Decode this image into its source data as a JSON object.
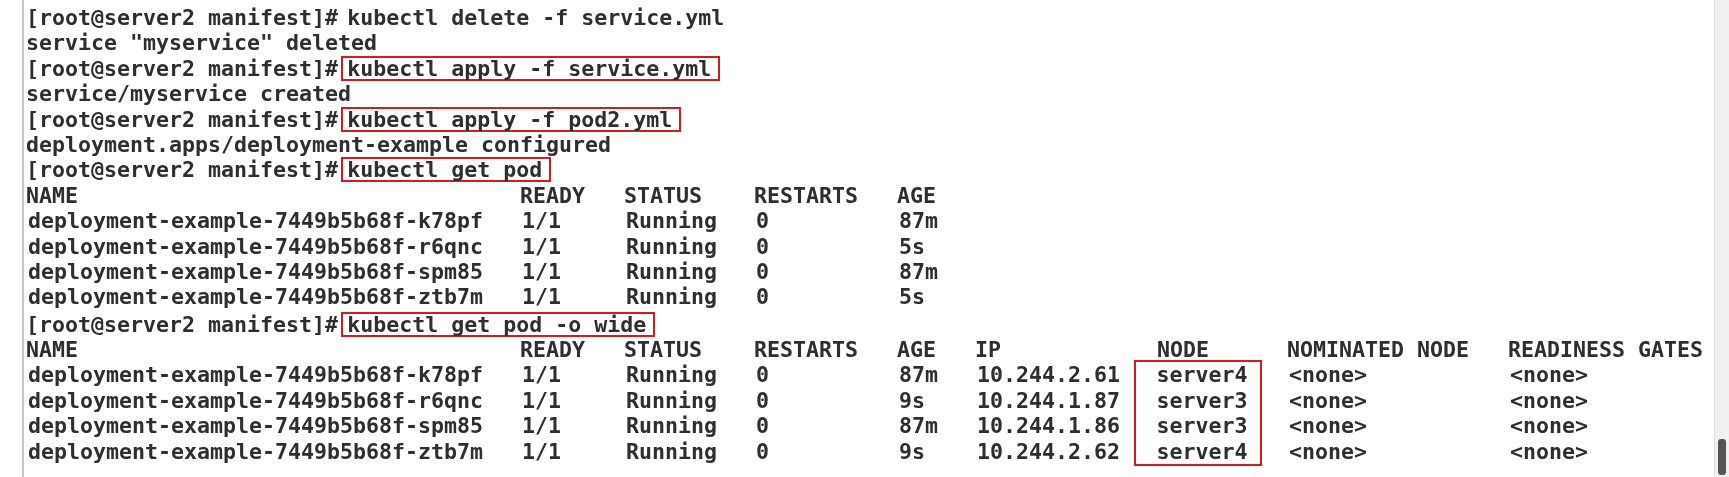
{
  "terminal": {
    "lines": [
      {
        "kind": "prompt",
        "prompt": "[root@server2 manifest]#",
        "command": "kubectl delete -f service.yml",
        "highlighted": false
      },
      {
        "kind": "output",
        "text": "service \"myservice\" deleted"
      },
      {
        "kind": "prompt",
        "prompt": "[root@server2 manifest]#",
        "command": "kubectl apply -f service.yml",
        "highlighted": true
      },
      {
        "kind": "output",
        "text": "service/myservice created"
      },
      {
        "kind": "prompt",
        "prompt": "[root@server2 manifest]#",
        "command": "kubectl apply -f pod2.yml",
        "highlighted": true
      },
      {
        "kind": "output",
        "text": "deployment.apps/deployment-example configured"
      },
      {
        "kind": "prompt",
        "prompt": "[root@server2 manifest]#",
        "command": "kubectl get pod",
        "highlighted": true
      },
      {
        "kind": "table",
        "columns": [
          {
            "header": "NAME",
            "boxed": false
          },
          {
            "header": "READY",
            "boxed": false
          },
          {
            "header": "STATUS",
            "boxed": false
          },
          {
            "header": "RESTARTS",
            "boxed": false
          },
          {
            "header": "AGE",
            "boxed": false
          }
        ],
        "rows": [
          [
            "deployment-example-7449b5b68f-k78pf",
            "1/1",
            "Running",
            "0",
            "87m"
          ],
          [
            "deployment-example-7449b5b68f-r6qnc",
            "1/1",
            "Running",
            "0",
            "5s"
          ],
          [
            "deployment-example-7449b5b68f-spm85",
            "1/1",
            "Running",
            "0",
            "87m"
          ],
          [
            "deployment-example-7449b5b68f-ztb7m",
            "1/1",
            "Running",
            "0",
            "5s"
          ]
        ]
      },
      {
        "kind": "prompt",
        "prompt": "[root@server2 manifest]#",
        "command": "kubectl get pod -o wide",
        "highlighted": true
      },
      {
        "kind": "table",
        "columns": [
          {
            "header": "NAME",
            "boxed": false
          },
          {
            "header": "READY",
            "boxed": false
          },
          {
            "header": "STATUS",
            "boxed": false
          },
          {
            "header": "RESTARTS",
            "boxed": false
          },
          {
            "header": "AGE",
            "boxed": false
          },
          {
            "header": "IP",
            "boxed": false
          },
          {
            "header": "NODE",
            "boxed": true
          },
          {
            "header": "NOMINATED NODE",
            "boxed": false
          },
          {
            "header": "READINESS GATES",
            "boxed": false
          }
        ],
        "rows": [
          [
            "deployment-example-7449b5b68f-k78pf",
            "1/1",
            "Running",
            "0",
            "87m",
            "10.244.2.61",
            "server4",
            "<none>",
            "<none>"
          ],
          [
            "deployment-example-7449b5b68f-r6qnc",
            "1/1",
            "Running",
            "0",
            "9s",
            "10.244.1.87",
            "server3",
            "<none>",
            "<none>"
          ],
          [
            "deployment-example-7449b5b68f-spm85",
            "1/1",
            "Running",
            "0",
            "87m",
            "10.244.1.86",
            "server3",
            "<none>",
            "<none>"
          ],
          [
            "deployment-example-7449b5b68f-ztb7m",
            "1/1",
            "Running",
            "0",
            "9s",
            "10.244.2.62",
            "server4",
            "<none>",
            "<none>"
          ]
        ]
      }
    ]
  }
}
